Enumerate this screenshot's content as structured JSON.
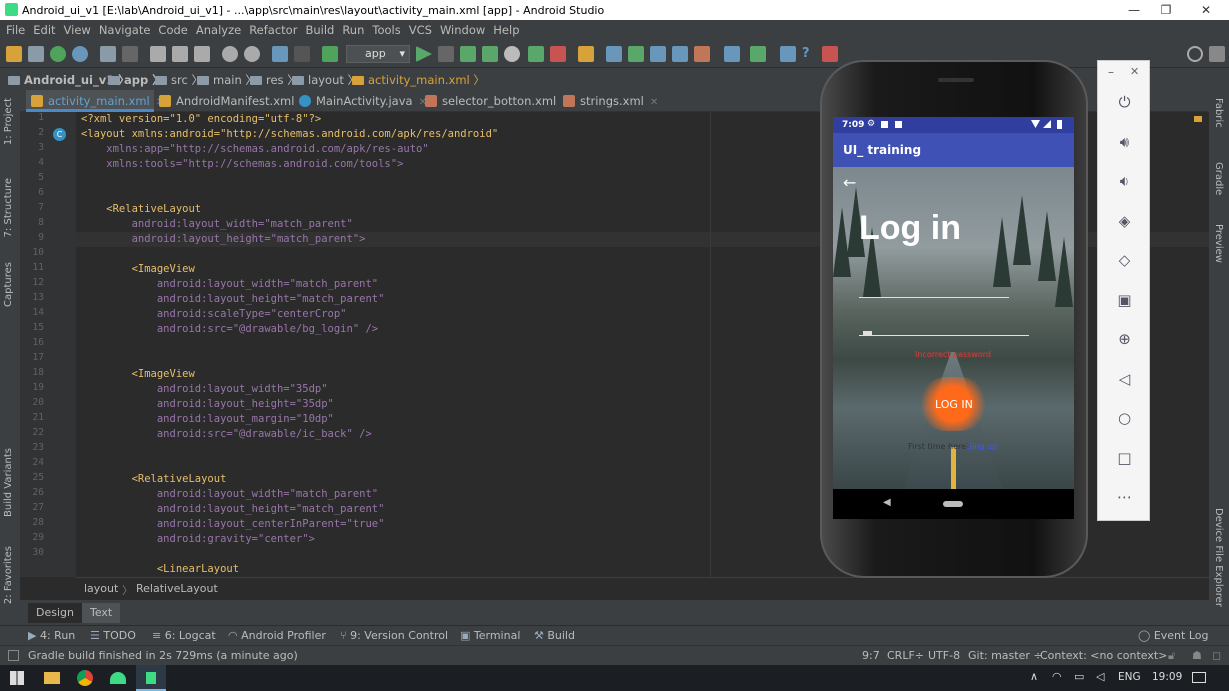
{
  "window": {
    "title": "Android_ui_v1 [E:\\lab\\Android_ui_v1] - ...\\app\\src\\main\\res\\layout\\activity_main.xml [app] - Android Studio",
    "controls": [
      "—",
      "❐",
      "✕"
    ]
  },
  "menu": [
    "File",
    "Edit",
    "View",
    "Navigate",
    "Code",
    "Analyze",
    "Refactor",
    "Build",
    "Run",
    "Tools",
    "VCS",
    "Window",
    "Help"
  ],
  "toolbar": {
    "run_config": "app"
  },
  "breadcrumb": [
    "Android_ui_v1",
    "app",
    "src",
    "main",
    "res",
    "layout",
    "activity_main.xml"
  ],
  "tabs": [
    {
      "label": "activity_main.xml",
      "active": true
    },
    {
      "label": "AndroidManifest.xml"
    },
    {
      "label": "MainActivity.java"
    },
    {
      "label": "selector_botton.xml"
    },
    {
      "label": "strings.xml"
    }
  ],
  "left_tools": [
    "1: Project",
    "7: Structure",
    "Captures",
    "Build Variants",
    "2: Favorites"
  ],
  "right_tools": [
    "Fabric",
    "Gradle",
    "Preview",
    "Device File Explorer"
  ],
  "editor": {
    "line_numbers": [
      "1",
      "2",
      "3",
      "4",
      "5",
      "6",
      "7",
      "8",
      "9",
      "10",
      "11",
      "12",
      "13",
      "14",
      "15",
      "16",
      "17",
      "18",
      "19",
      "20",
      "21",
      "22",
      "23",
      "24",
      "25",
      "26",
      "27",
      "28",
      "29",
      "30"
    ],
    "lines": [
      "<?xml version=\"1.0\" encoding=\"utf-8\"?>",
      "<layout xmlns:android=\"http://schemas.android.com/apk/res/android\"",
      "    xmlns:app=\"http://schemas.android.com/apk/res-auto\"",
      "    xmlns:tools=\"http://schemas.android.com/tools\">",
      "",
      "",
      "    <RelativeLayout",
      "        android:layout_width=\"match_parent\"",
      "        android:layout_height=\"match_parent\">",
      "",
      "        <ImageView",
      "            android:layout_width=\"match_parent\"",
      "            android:layout_height=\"match_parent\"",
      "            android:scaleType=\"centerCrop\"",
      "            android:src=\"@drawable/bg_login\" />",
      "",
      "",
      "        <ImageView",
      "            android:layout_width=\"35dp\"",
      "            android:layout_height=\"35dp\"",
      "            android:layout_margin=\"10dp\"",
      "            android:src=\"@drawable/ic_back\" />",
      "",
      "",
      "        <RelativeLayout",
      "            android:layout_width=\"match_parent\"",
      "            android:layout_height=\"match_parent\"",
      "            android:layout_centerInParent=\"true\"",
      "            android:gravity=\"center\">",
      "",
      "            <LinearLayout"
    ],
    "xml_path": [
      "layout",
      "RelativeLayout"
    ]
  },
  "design_tabs": [
    "Design",
    "Text"
  ],
  "tool_windows": [
    "4: Run",
    "TODO",
    "6: Logcat",
    "Android Profiler",
    "9: Version Control",
    "Terminal",
    "Build",
    "Event Log"
  ],
  "status": {
    "message": "Gradle build finished in 2s 729ms (a minute ago)",
    "position": "9:7",
    "line_sep": "CRLF÷",
    "encoding": "UTF-8",
    "git": "Git: master ÷",
    "context": "Context: <no context>"
  },
  "taskbar": {
    "lang": "ENG",
    "time": "19:09"
  },
  "emulator": {
    "status_time": "7:09",
    "app_title": "UI_ training",
    "heading": "Log in",
    "error_text": "Incorrect password",
    "login_button": "LOG IN",
    "first_time": "First time here?",
    "sign_up": "Sing up"
  },
  "colors": {
    "accent": "#4a88c7",
    "app_bar": "#3f51b5",
    "login_glow": "#ff6a1a",
    "sign_up_link": "#3d5afe"
  }
}
